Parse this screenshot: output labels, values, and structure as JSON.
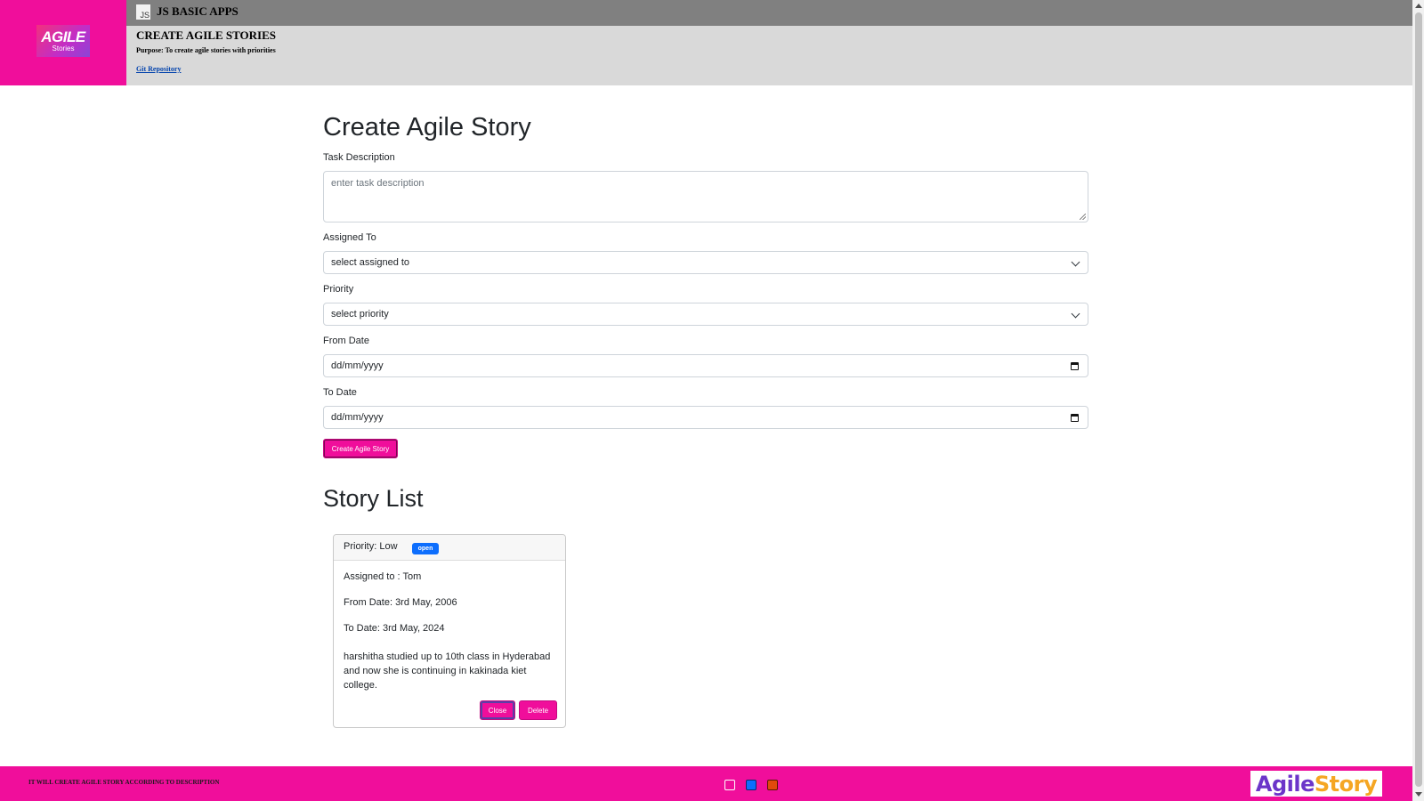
{
  "header": {
    "logo_text": "AGILE",
    "logo_sub": "Stories",
    "js_icon": "JS",
    "app_title": "JS BASIC APPS",
    "title": "CREATE AGILE STORIES",
    "purpose": "Purpose: To create agile stories with priorities",
    "repo_link": "Git Repository"
  },
  "form": {
    "title": "Create Agile Story",
    "task_label": "Task Description",
    "task_placeholder": "enter task description",
    "assigned_label": "Assigned To",
    "assigned_value": "select assigned to",
    "priority_label": "Priority",
    "priority_value": "select priority",
    "from_label": "From Date",
    "from_value": "dd/mm/yyyy",
    "to_label": "To Date",
    "to_value": "dd/mm/yyyy",
    "submit_label": "Create Agile Story"
  },
  "list": {
    "title": "Story List",
    "stories": [
      {
        "priority": "Priority: Low",
        "status": "open",
        "assigned": "Assigned to : Tom",
        "from": "From Date: 3rd May, 2006",
        "to": "To Date: 3rd May, 2024",
        "description": "harshitha studied up to 10th class in Hyderabad and now she is continuing in kakinada kiet college.",
        "close_label": "Close",
        "delete_label": "Delete"
      }
    ]
  },
  "footer": {
    "text": "IT WILL CREATE AGILE STORY ACCORDING TO DESCRIPTION",
    "logo_part1": "Agile",
    "logo_part2": "Story",
    "theme_colors": [
      "#f00e9b",
      "#0d6efd",
      "#e04a0c"
    ]
  },
  "colors": {
    "accent": "#f00e9b",
    "header_gray": "#808080",
    "subheader_gray": "#d9d9d9",
    "badge_blue": "#0d6efd"
  }
}
